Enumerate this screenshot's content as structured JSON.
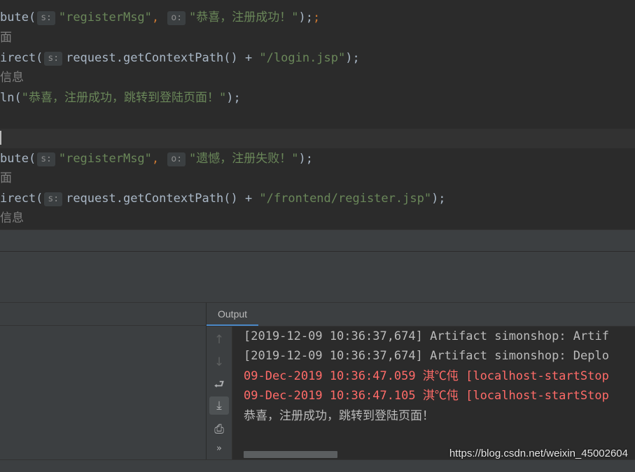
{
  "editor": {
    "lines": [
      {
        "code": "bute(",
        "hint": "s:",
        "arg1": "\"registerMsg\"",
        "sep": ", ",
        "hint2": "o:",
        "arg2": "\"恭喜，注册成功！\"",
        "end": ");"
      },
      {
        "comment": "面"
      },
      {
        "code": "irect(",
        "hint": "s:",
        "expr": "request.getContextPath() + ",
        "str": "\"/login.jsp\"",
        "end": ");"
      },
      {
        "comment": "信息"
      },
      {
        "code": "ln(",
        "str": "\"恭喜，注册成功，跳转到登陆页面！\"",
        "end": ");"
      },
      {},
      {
        "caret": true
      },
      {
        "code": "bute(",
        "hint": "s:",
        "arg1": "\"registerMsg\"",
        "sep": ", ",
        "hint2": "o:",
        "arg2": "\"遗憾，注册失败！\"",
        "end": ");"
      },
      {
        "comment": "面"
      },
      {
        "code": "irect(",
        "hint": "s:",
        "expr": "request.getContextPath() + ",
        "str": "\"/frontend/register.jsp\"",
        "end": ");"
      },
      {
        "comment": "信息"
      }
    ]
  },
  "output_panel": {
    "tab_label": "Output",
    "toolbar": [
      {
        "icon": "arrow-up-icon",
        "glyph": "↑"
      },
      {
        "icon": "arrow-down-icon",
        "glyph": "↓"
      },
      {
        "icon": "soft-wrap-icon",
        "glyph": "⮐"
      },
      {
        "icon": "scroll-to-end-icon",
        "glyph": "⤓"
      },
      {
        "icon": "print-icon",
        "glyph": "⎙"
      },
      {
        "icon": "more-icon",
        "glyph": "»"
      }
    ],
    "lines": [
      {
        "text": "[2019-12-09 10:36:37,674] Artifact simonshop: Artif",
        "type": "info"
      },
      {
        "text": "[2019-12-09 10:36:37,674] Artifact simonshop: Deplo",
        "type": "info"
      },
      {
        "text": "09-Dec-2019 10:36:47.059 淇℃伅 [localhost-startStop",
        "type": "error"
      },
      {
        "text": "09-Dec-2019 10:36:47.105 淇℃伅 [localhost-startStop",
        "type": "error"
      },
      {
        "text": "恭喜，注册成功，跳转到登陆页面！",
        "type": "zh"
      }
    ]
  },
  "watermark": "https://blog.csdn.net/weixin_45002604",
  "colors": {
    "string": "#6a8759",
    "keyword": "#cc7832",
    "plain": "#a9b7c6",
    "comment": "#808080",
    "error": "#ff6b68",
    "accent": "#4a88c7"
  }
}
